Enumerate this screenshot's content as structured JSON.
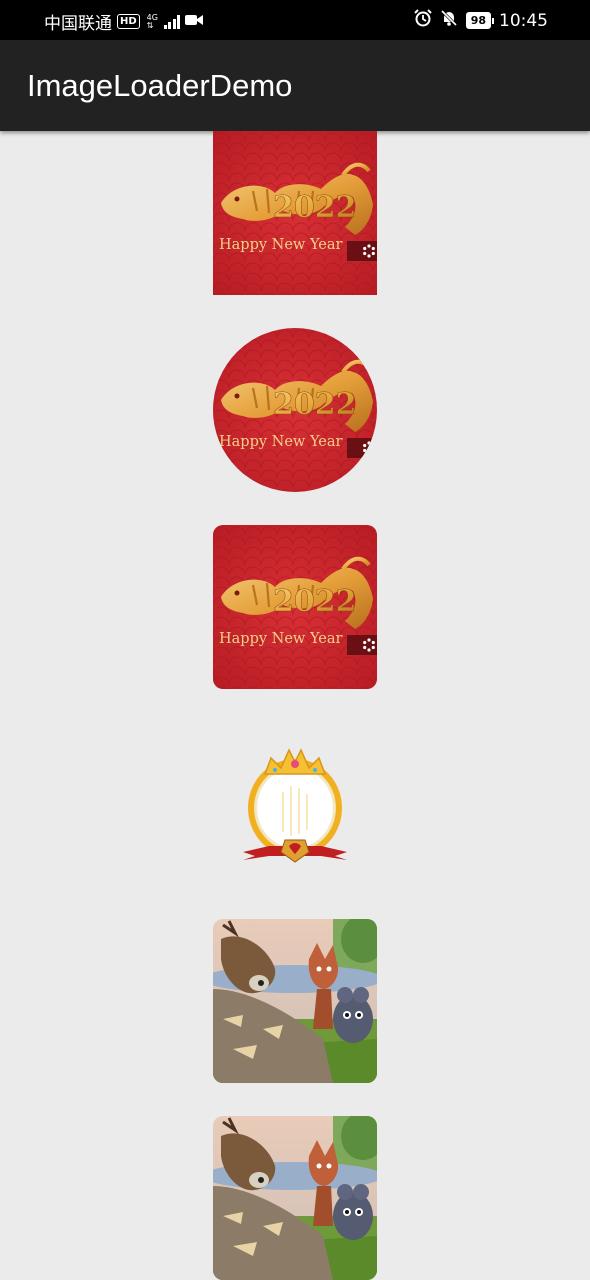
{
  "status_bar": {
    "carrier": "中国联通",
    "hd_badge": "HD",
    "network_type": "4G",
    "battery_level": "98",
    "time": "10:45"
  },
  "app_bar": {
    "title": "ImageLoaderDemo"
  },
  "images": {
    "new_year_text": "Happy New Year",
    "year": "2022"
  },
  "colors": {
    "status_bar_bg": "#000000",
    "app_bar_bg": "#222222",
    "page_bg": "#ebebeb",
    "poster_red": "#c8252b",
    "poster_gold": "#e6a53a"
  }
}
